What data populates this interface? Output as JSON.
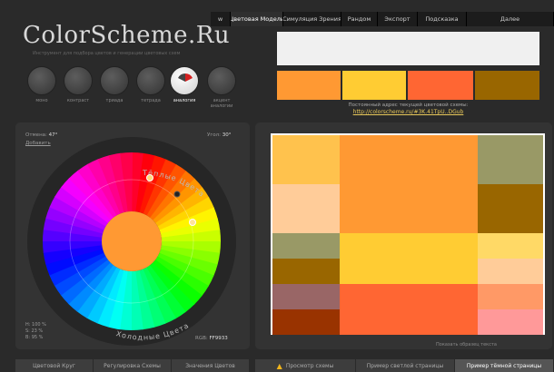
{
  "nav": {
    "tabs": [
      {
        "label": "w"
      },
      {
        "label": "Цветовая Модель",
        "active": true
      },
      {
        "label": "Симуляция Зрения"
      },
      {
        "label": "Рандом"
      },
      {
        "label": "Экспорт"
      },
      {
        "label": "Подсказка"
      },
      {
        "label": "Далее"
      }
    ]
  },
  "header": {
    "logo": "ColorScheme.Ru",
    "tagline": "Инструмент для подбора цветов и генерации цветовых схем"
  },
  "modes": [
    {
      "label": "моно"
    },
    {
      "label": "контраст"
    },
    {
      "label": "триада"
    },
    {
      "label": "тетрада"
    },
    {
      "label": "аналогия",
      "active": true
    },
    {
      "label": "акцент аналогии"
    }
  ],
  "wheel_panel": {
    "shift_label": "Отмена:",
    "shift_value": "47°",
    "sub_label": "Добавить",
    "angle_label": "Угол:",
    "angle_value": "30°",
    "warm_label": "Тёплые Цвета",
    "cold_label": "Холодные Цвета",
    "hsb": [
      "H: 100 %",
      "S: 23 %",
      "B: 95 %"
    ],
    "rgb_label": "RGB:",
    "rgb_value": "FF9933",
    "base_color": "#FF9933"
  },
  "left_tabs": [
    "Цветовой Круг",
    "Регулировка Схемы",
    "Значения Цветов"
  ],
  "scheme": {
    "preview_bg": "#F0F0F0",
    "swatches": [
      "#FF9933",
      "#FFCC33",
      "#FF6633",
      "#996600"
    ],
    "link_caption": "Постоянный адрес текущей цветовой схемы:",
    "link_url": "http://colorscheme.ru/#3K.41TpU..DGub"
  },
  "preview": {
    "note": "Показать образец текста",
    "colors": {
      "orange": "#FF9933",
      "lightOrange": "#FFC24D",
      "peach": "#FFCC99",
      "olive": "#999966",
      "brown": "#996600",
      "gold": "#FFCC33",
      "lightGold": "#FFD966",
      "mauve": "#996666",
      "tomato": "#FF6633",
      "salmon": "#FF9966",
      "rust": "#993300",
      "pink": "#FF9999"
    }
  },
  "right_tabs": [
    "Просмотр схемы",
    "Пример светлой страницы",
    "Пример тёмной страницы"
  ]
}
